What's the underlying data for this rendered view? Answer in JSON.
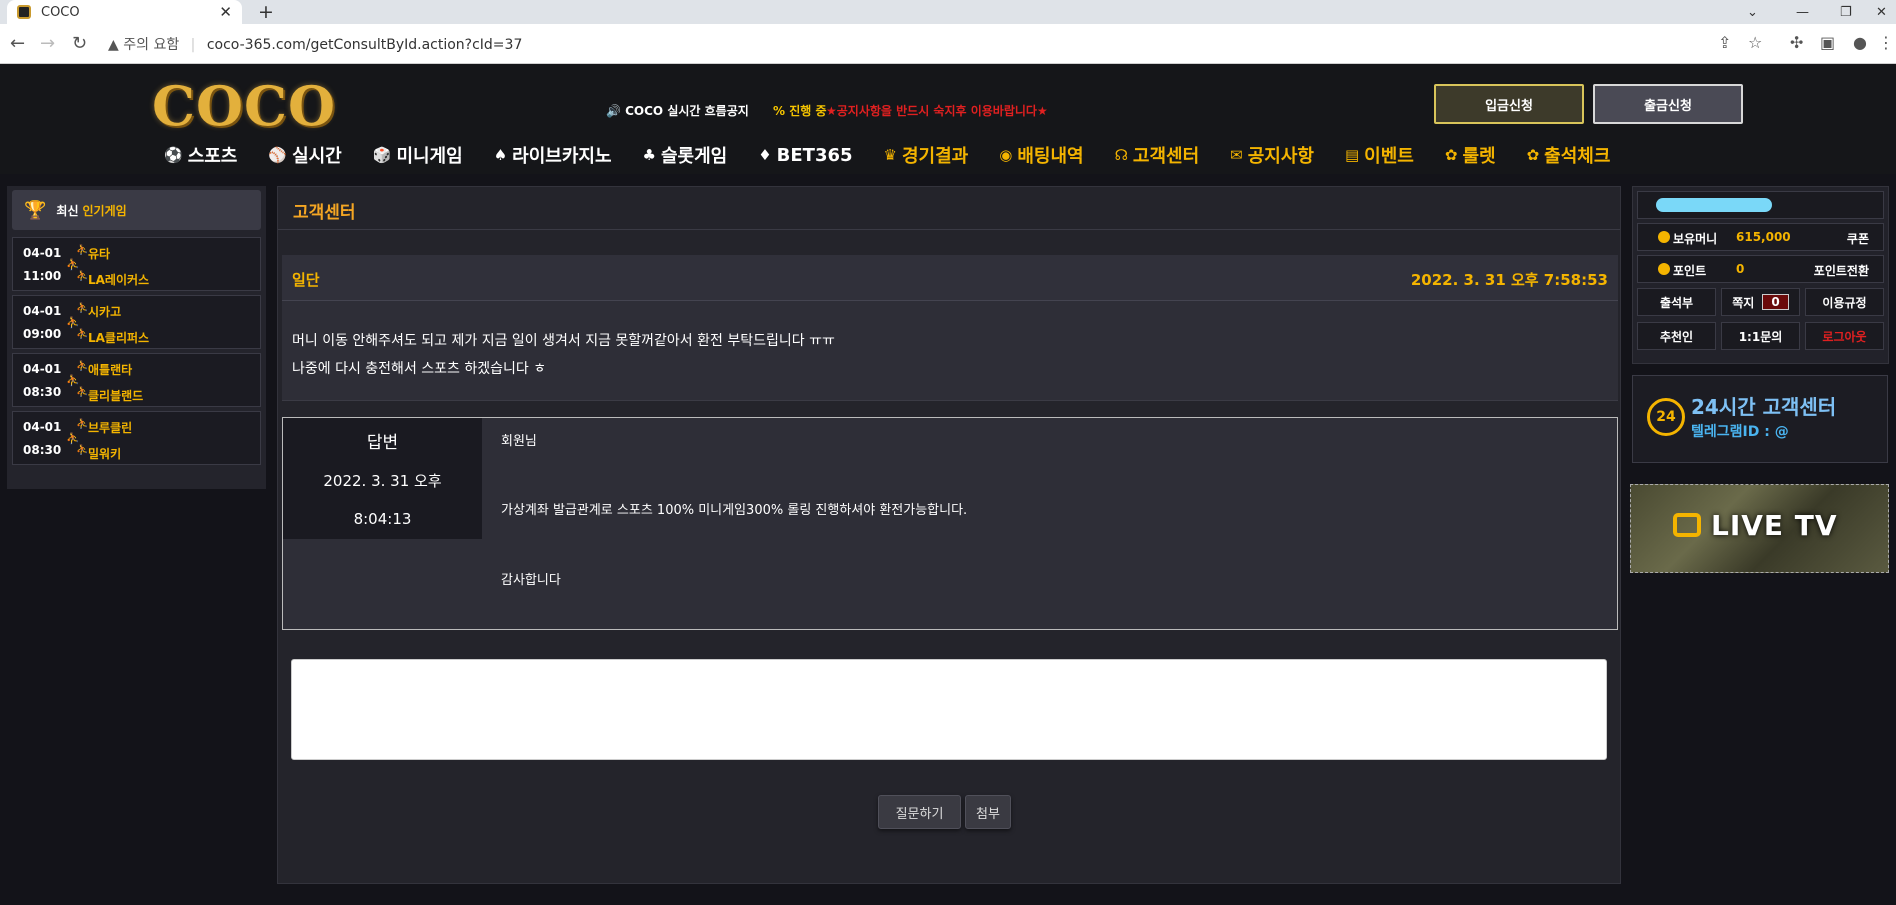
{
  "browser": {
    "tab_title": "COCO",
    "tab_close": "✕",
    "new_tab": "+",
    "security_label": "주의 요함",
    "url": "coco-365.com/getConsultById.action?cId=37"
  },
  "header": {
    "logo": "COCO",
    "notice_title": "🔊 COCO 실시간 흐름공지",
    "notice_progress": "% 진행 중",
    "notice_text": "★공지사항을 반드시 숙지후 이용바랍니다★",
    "deposit_label": "입금신청",
    "withdraw_label": "출금신청"
  },
  "nav": [
    {
      "label": "스포츠",
      "icon": "⚽",
      "color": "white"
    },
    {
      "label": "실시간",
      "icon": "⚾",
      "color": "white"
    },
    {
      "label": "미니게임",
      "icon": "🎲",
      "color": "white"
    },
    {
      "label": "라이브카지노",
      "icon": "♠",
      "color": "white"
    },
    {
      "label": "슬롯게임",
      "icon": "♣",
      "color": "white"
    },
    {
      "label": "BET365",
      "icon": "♦",
      "color": "white"
    },
    {
      "label": "경기결과",
      "icon": "♛",
      "color": "gold"
    },
    {
      "label": "배팅내역",
      "icon": "◉",
      "color": "gold"
    },
    {
      "label": "고객센터",
      "icon": "☊",
      "color": "gold"
    },
    {
      "label": "공지사항",
      "icon": "✉",
      "color": "gold"
    },
    {
      "label": "이벤트",
      "icon": "▤",
      "color": "gold"
    },
    {
      "label": "룰렛",
      "icon": "✿",
      "color": "gold"
    },
    {
      "label": "출석체크",
      "icon": "✿",
      "color": "gold"
    }
  ],
  "left_panel": {
    "head_white": "최신",
    "head_gold": "인기게임",
    "games": [
      {
        "date": "04-01",
        "time": "11:00",
        "team1": "유타",
        "team2": "LA레이커스"
      },
      {
        "date": "04-01",
        "time": "09:00",
        "team1": "시카고",
        "team2": "LA클리퍼스"
      },
      {
        "date": "04-01",
        "time": "08:30",
        "team1": "애틀랜타",
        "team2": "클리블랜드"
      },
      {
        "date": "04-01",
        "time": "08:30",
        "team1": "브루클린",
        "team2": "밀워키"
      }
    ]
  },
  "main": {
    "title": "고객센터",
    "question": {
      "title": "일단",
      "datetime": "2022. 3. 31 오후 7:58:53",
      "line1": "머니 이동 안해주셔도 되고 제가 지금 일이 생겨서 지금 못할꺼같아서 환전 부탁드립니다 ㅠㅠ",
      "line2": "나중에 다시 충전해서 스포츠 하겠습니다 ㅎ"
    },
    "answer": {
      "label": "답변",
      "date_line1": "2022. 3. 31 오후",
      "date_line2": "8:04:13",
      "greeting": "회원님",
      "body": "가상계좌 발급관계로 스포츠 100% 미니게임300% 롤링 진행하셔야 환전가능합니다.",
      "closing": "감사합니다"
    },
    "ask_button": "질문하기",
    "attach_button": "첨부"
  },
  "right_panel": {
    "money_label": "보유머니",
    "money_value": "615,000",
    "coupon_label": "쿠폰",
    "point_label": "포인트",
    "point_value": "0",
    "point_convert_label": "포인트전환",
    "attendance_label": "출석부",
    "note_label": "쪽지",
    "note_count": "0",
    "terms_label": "이용규정",
    "recommender_label": "추천인",
    "inquiry_label": "1:1문의",
    "logout_label": "로그아웃",
    "cs_badge": "24",
    "cs_title": "24시간 고객센터",
    "cs_telegram": "텔레그램ID : @",
    "live_tv": "LIVE TV"
  }
}
